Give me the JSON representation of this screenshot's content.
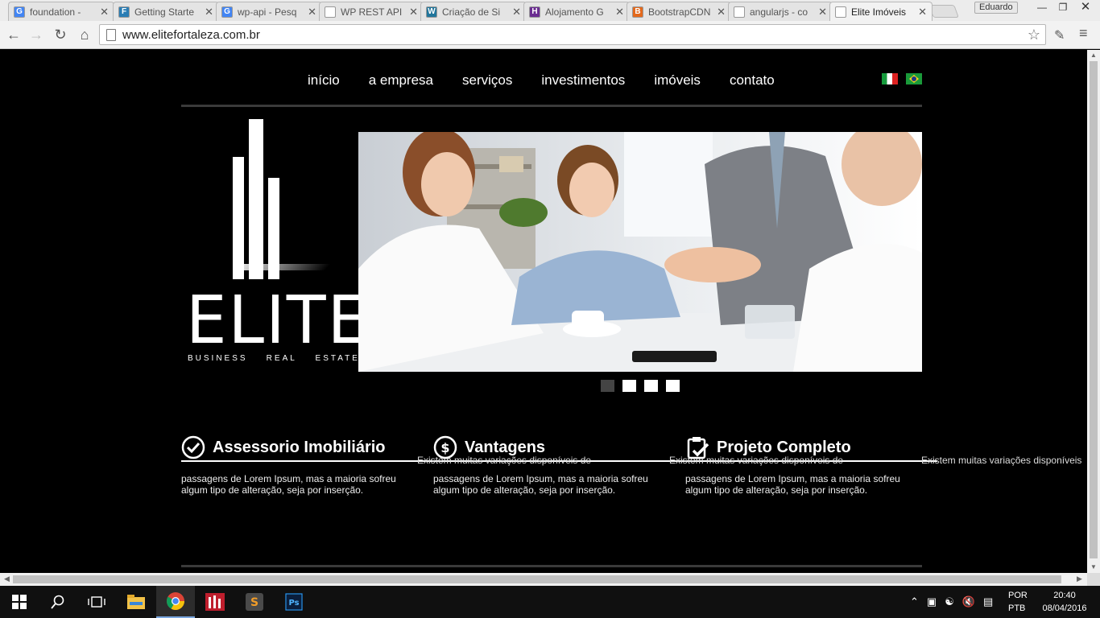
{
  "browser": {
    "tabs": [
      {
        "title": "foundation -",
        "favicon_letter": "G",
        "favicon_color": "#4285f4",
        "active": false
      },
      {
        "title": "Getting Starte",
        "favicon_letter": "F",
        "favicon_color": "#2a7db4",
        "active": false
      },
      {
        "title": "wp-api - Pesq",
        "favicon_letter": "G",
        "favicon_color": "#4285f4",
        "active": false
      },
      {
        "title": "WP REST API",
        "favicon_letter": "",
        "favicon_color": "#ffffff",
        "active": false
      },
      {
        "title": "Criação de Si",
        "favicon_letter": "W",
        "favicon_color": "#21759b",
        "active": false
      },
      {
        "title": "Alojamento G",
        "favicon_letter": "H",
        "favicon_color": "#6a2c91",
        "active": false
      },
      {
        "title": "BootstrapCDN",
        "favicon_letter": "B",
        "favicon_color": "#e4691c",
        "active": false
      },
      {
        "title": "angularjs - co",
        "favicon_letter": "C",
        "favicon_color": "#ffffff",
        "active": false
      },
      {
        "title": "Elite Imóveis",
        "favicon_letter": "",
        "favicon_color": "#ffffff",
        "active": true
      }
    ],
    "profile_name": "Eduardo",
    "url": "www.elitefortaleza.com.br"
  },
  "site": {
    "nav": [
      "início",
      "a empresa",
      "serviços",
      "investimentos",
      "imóveis",
      "contato"
    ],
    "logo": {
      "word": "ELITE",
      "tagline": "BUSINESS    REAL    ESTATE"
    },
    "slider": {
      "dot_count": 4,
      "active_index": 0
    },
    "features": [
      {
        "title": "Assessorio Imobiliário",
        "icon": "check-circle-icon",
        "intro": "",
        "body": "passagens de Lorem Ipsum, mas a maioria sofreu algum tipo de alteração, seja por inserção."
      },
      {
        "title": "Vantagens",
        "icon": "dollar-circle-icon",
        "intro": "Existem muitas variações disponíveis de",
        "body": "passagens de Lorem Ipsum, mas a maioria sofreu algum tipo de alteração, seja por inserção."
      },
      {
        "title": "Projeto Completo",
        "icon": "clipboard-check-icon",
        "intro": "Existem muitas variações disponíveis de",
        "body": "passagens de Lorem Ipsum, mas a maioria sofreu algum tipo de alteração, seja por inserção."
      }
    ],
    "overflow_text": "Existem muitas variações disponíveis"
  },
  "taskbar": {
    "language": [
      "POR",
      "PTB"
    ],
    "time": "20:40",
    "date": "08/04/2016"
  },
  "colors": {
    "page_bg": "#000000",
    "text": "#ffffff",
    "rule": "#3a3a3a",
    "dot_active": "#444444"
  }
}
